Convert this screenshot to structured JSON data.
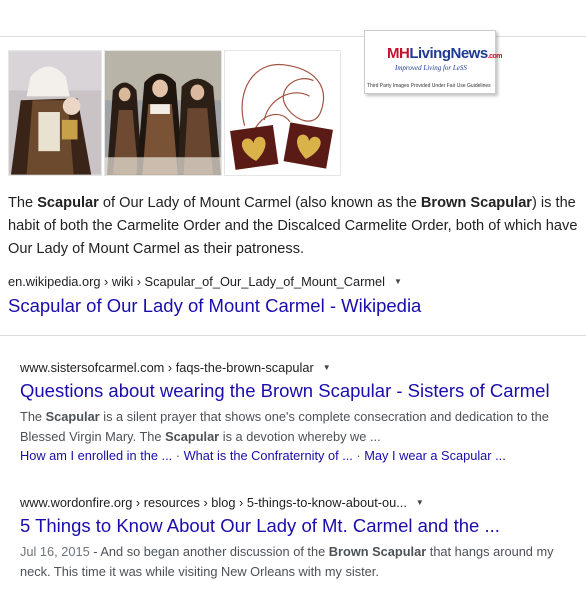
{
  "images": {
    "logo_text_mh": "MH",
    "logo_text_living": "Living",
    "logo_text_news": "News",
    "logo_text_domain": ".com",
    "logo_tagline": "Improved Living for LeSS",
    "logo_note": "Third Party Images Provided Under Fair Use Guidelines"
  },
  "featured": {
    "snippet": {
      "p1": "The ",
      "b1": "Scapular",
      "p2": " of Our Lady of Mount Carmel (also known as the ",
      "b2": "Brown Scapular",
      "p3": ") is the habit of both the Carmelite Order and the Discalced Carmelite Order, both of which have Our Lady of Mount Carmel as their patroness."
    },
    "cite": "en.wikipedia.org › wiki › Scapular_of_Our_Lady_of_Mount_Carmel",
    "title": "Scapular of Our Lady of Mount Carmel - Wikipedia"
  },
  "results": [
    {
      "cite": "www.sistersofcarmel.com › faqs-the-brown-scapular",
      "title": "Questions about wearing the Brown Scapular - Sisters of Carmel",
      "desc": {
        "p1": "The ",
        "b1": "Scapular",
        "p2": " is a silent prayer that shows one's complete consecration and dedication to the Blessed Virgin Mary. The ",
        "b2": "Scapular",
        "p3": " is a devotion whereby we ..."
      },
      "sitelinks": [
        "How am I enrolled in the ...",
        "What is the Confraternity of ...",
        "May I wear a Scapular ..."
      ],
      "sitelink_sep": " · "
    },
    {
      "cite": "www.wordonfire.org › resources › blog › 5-things-to-know-about-ou...",
      "title": "5 Things to Know About Our Lady of Mt. Carmel and the ...",
      "desc": {
        "date": "Jul 16, 2015",
        "p1": " - And so began another discussion of the ",
        "b1": "Brown Scapular",
        "p2": " that hangs around my neck. This time it was while visiting New Orleans with my sister."
      }
    }
  ],
  "icons": {
    "dropdown": "▼"
  }
}
